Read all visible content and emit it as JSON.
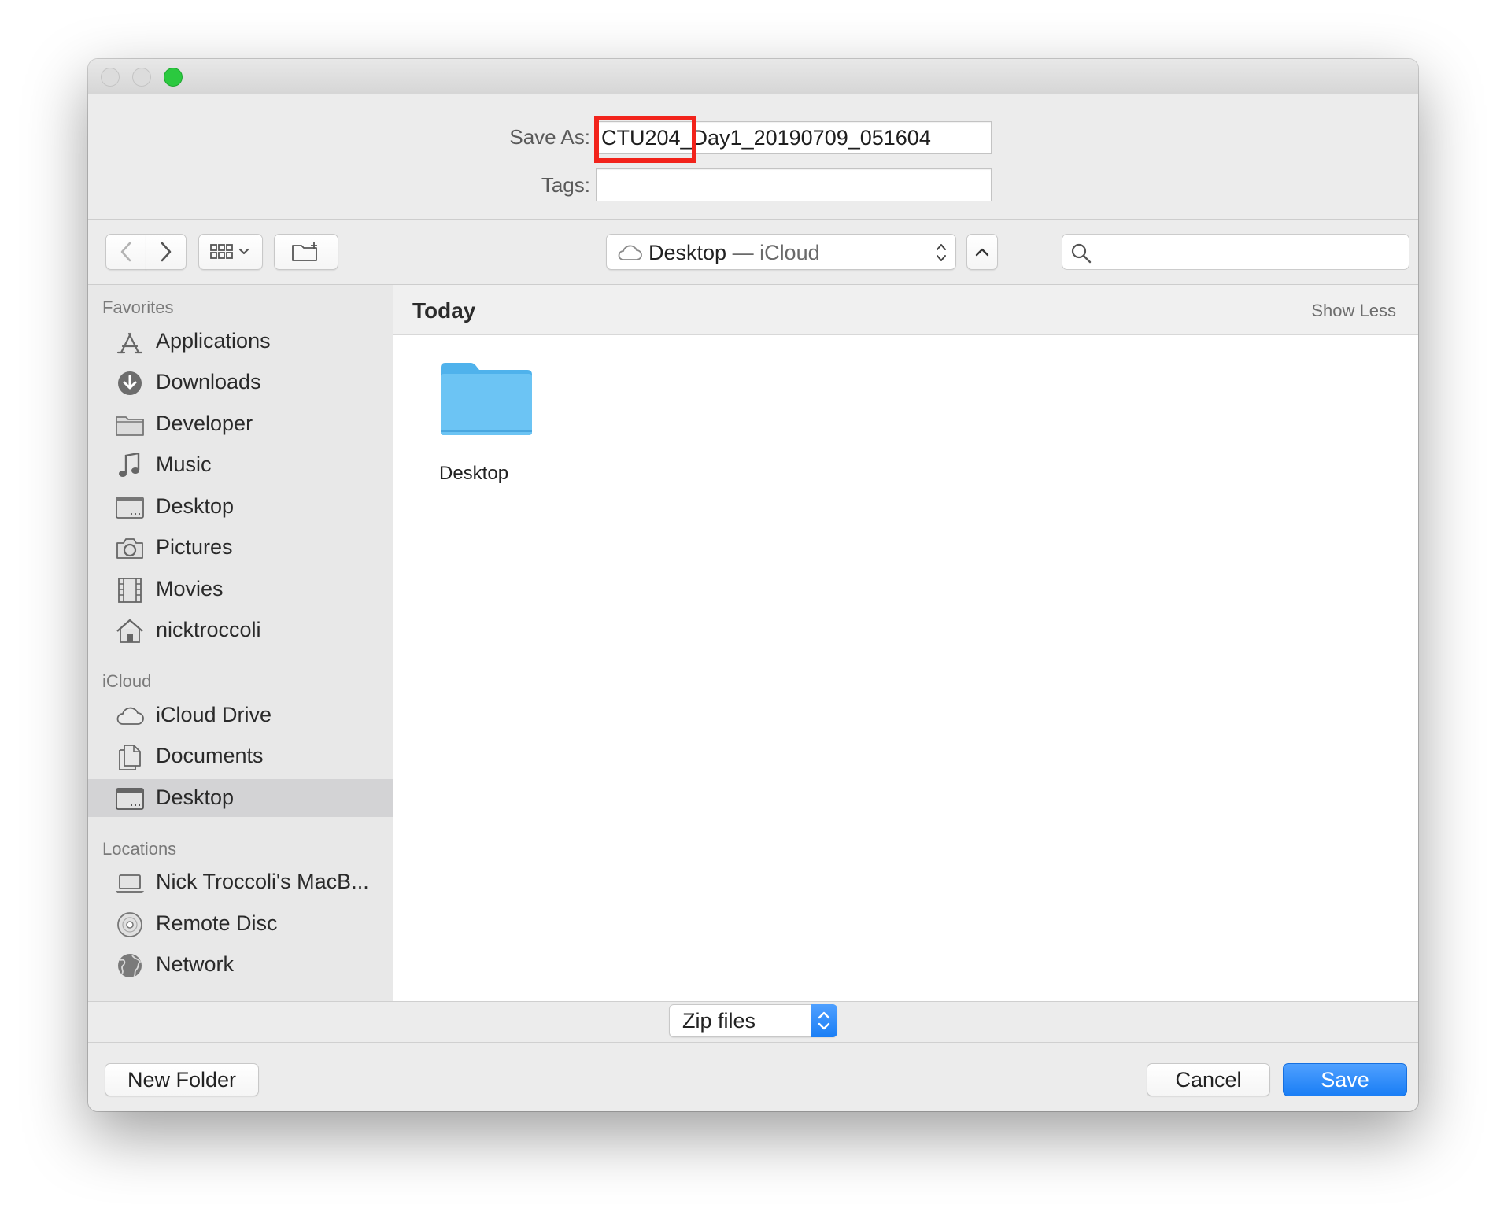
{
  "window": {
    "traffic_lights": [
      "close-light",
      "minimize-light",
      "zoom-light"
    ]
  },
  "form": {
    "save_as_label": "Save As:",
    "save_as_value": "CTU204_Day1_20190709_051604",
    "tags_label": "Tags:",
    "tags_value": ""
  },
  "toolbar": {
    "back_icon": "chevron-left-icon",
    "forward_icon": "chevron-right-icon",
    "view_icon": "grid-view-icon",
    "new_folder_icon": "new-folder-icon",
    "location_primary": "Desktop",
    "location_secondary": " — iCloud",
    "search_placeholder": ""
  },
  "sidebar": {
    "sections": [
      {
        "title": "Favorites",
        "items": [
          {
            "label": "Applications",
            "icon": "applications-icon"
          },
          {
            "label": "Downloads",
            "icon": "downloads-icon"
          },
          {
            "label": "Developer",
            "icon": "folder-icon"
          },
          {
            "label": "Music",
            "icon": "music-icon"
          },
          {
            "label": "Desktop",
            "icon": "desktop-icon"
          },
          {
            "label": "Pictures",
            "icon": "camera-icon"
          },
          {
            "label": "Movies",
            "icon": "film-icon"
          },
          {
            "label": "nicktroccoli",
            "icon": "home-icon"
          }
        ]
      },
      {
        "title": "iCloud",
        "items": [
          {
            "label": "iCloud Drive",
            "icon": "cloud-icon"
          },
          {
            "label": "Documents",
            "icon": "documents-icon"
          },
          {
            "label": "Desktop",
            "icon": "desktop-icon",
            "selected": true
          }
        ]
      },
      {
        "title": "Locations",
        "items": [
          {
            "label": "Nick Troccoli's MacB...",
            "icon": "laptop-icon"
          },
          {
            "label": "Remote Disc",
            "icon": "disc-icon"
          },
          {
            "label": "Network",
            "icon": "globe-icon"
          }
        ]
      }
    ]
  },
  "content": {
    "group_title": "Today",
    "show_less": "Show Less",
    "files": [
      {
        "name": "Desktop",
        "icon": "folder-icon",
        "color": "#6cc4f4"
      }
    ]
  },
  "footer": {
    "format_value": "Zip files",
    "new_folder": "New Folder",
    "cancel": "Cancel",
    "save": "Save"
  },
  "colors": {
    "accent": "#1a7ef5",
    "highlight_box": "#f2231b",
    "zoom_light": "#2bc93f"
  }
}
